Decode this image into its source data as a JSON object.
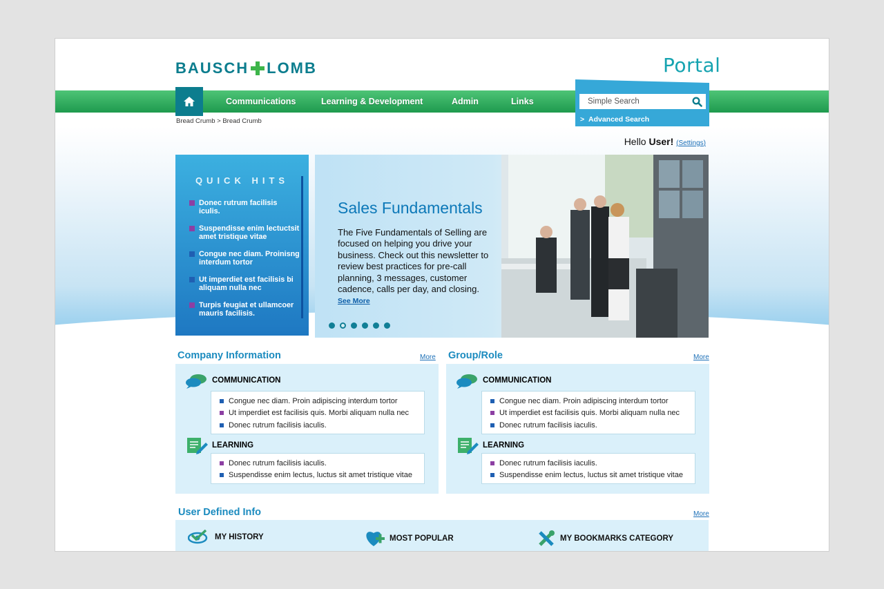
{
  "brand": {
    "logo_left": "BAUSCH",
    "logo_right": "LOMB",
    "portal_title": "Portal"
  },
  "nav": {
    "home_icon": "home-icon",
    "items": [
      {
        "label": "Communications"
      },
      {
        "label": "Learning & Development"
      },
      {
        "label": "Admin"
      },
      {
        "label": "Links"
      }
    ]
  },
  "search": {
    "placeholder": "Simple Search",
    "advanced_label": "Advanced Search",
    "advanced_prefix": ">"
  },
  "breadcrumb": "Bread Crumb > Bread Crumb",
  "greeting": {
    "hello": "Hello",
    "user": "User!",
    "settings": "Settings",
    "open_paren": "(",
    "close_paren": ")"
  },
  "quick_hits": {
    "title": "QUICK HITS",
    "items": [
      {
        "label": "Donec rutrum facilisis iculis.",
        "bullet": "purple"
      },
      {
        "label": "Suspendisse enim lectuctsit amet tristique vitae",
        "bullet": "purple"
      },
      {
        "label": "Congue nec diam. Proinisng interdum tortor",
        "bullet": "blue"
      },
      {
        "label": "Ut imperdiet est facilisis bi aliquam nulla nec",
        "bullet": "blue"
      },
      {
        "label": "Turpis feugiat et ullamcoer mauris facilisis.",
        "bullet": "purple"
      }
    ]
  },
  "slide": {
    "title": "Sales Fundamentals",
    "body": "The Five Fundamentals of Selling are focused on helping you drive your business. Check out this newsletter to review best practices for pre-call planning, 3 messages, customer cadence, calls per day, and closing.",
    "see_more": "See More",
    "dot_count": 6,
    "active_dot": 2
  },
  "company_info": {
    "title": "Company Information",
    "more": "More",
    "communication_title": "COMMUNICATION",
    "communication_items": [
      {
        "label": "Congue nec diam. Proin adipiscing interdum tortor",
        "bullet": "blue"
      },
      {
        "label": "Ut imperdiet est facilisis quis. Morbi aliquam nulla nec",
        "bullet": "purple"
      },
      {
        "label": "Donec rutrum facilisis iaculis.",
        "bullet": "blue"
      }
    ],
    "learning_title": "LEARNING",
    "learning_items": [
      {
        "label": "Donec rutrum facilisis iaculis.",
        "bullet": "purple"
      },
      {
        "label": "Suspendisse enim lectus, luctus sit amet tristique vitae",
        "bullet": "blue"
      }
    ]
  },
  "group_role": {
    "title": "Group/Role",
    "more": "More",
    "communication_title": "COMMUNICATION",
    "communication_items": [
      {
        "label": "Congue nec diam. Proin adipiscing interdum tortor",
        "bullet": "blue"
      },
      {
        "label": "Ut imperdiet est facilisis quis. Morbi aliquam nulla nec",
        "bullet": "purple"
      },
      {
        "label": "Donec rutrum facilisis iaculis.",
        "bullet": "blue"
      }
    ],
    "learning_title": "LEARNING",
    "learning_items": [
      {
        "label": "Donec rutrum facilisis iaculis.",
        "bullet": "purple"
      },
      {
        "label": "Suspendisse enim lectus, luctus sit amet tristique vitae",
        "bullet": "blue"
      }
    ]
  },
  "user_defined": {
    "title": "User Defined Info",
    "more": "More",
    "history": "MY HISTORY",
    "popular": "MOST POPULAR",
    "bookmarks": "MY BOOKMARKS CATEGORY"
  },
  "colors": {
    "brand_teal": "#0c7d8e",
    "nav_green": "#2aa95a",
    "link_blue": "#1b6fb7",
    "heading_blue": "#1b8bbf",
    "panel_bg": "#daf0fa"
  }
}
